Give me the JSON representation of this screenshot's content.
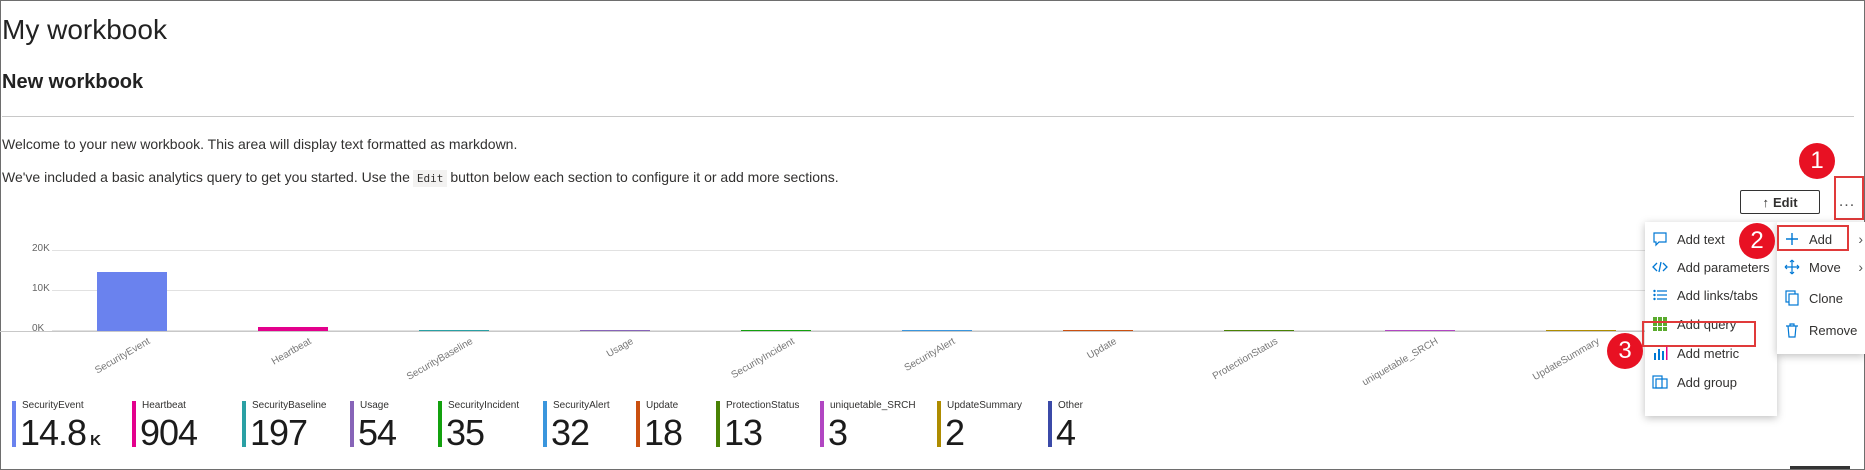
{
  "page": {
    "title": "My workbook",
    "section_title": "New workbook",
    "intro_line1": "Welcome to your new workbook. This area will display text formatted as markdown.",
    "intro_line2_pre": "We've included a basic analytics query to get you started. Use the",
    "intro_line2_code": "Edit",
    "intro_line2_post": "button below each section to configure it or add more sections."
  },
  "toolbar": {
    "edit_label": "Edit",
    "edit_icon": "up-arrow-icon",
    "more_label": "..."
  },
  "callouts": [
    "1",
    "2",
    "3"
  ],
  "chart_data": {
    "type": "bar",
    "categories": [
      "SecurityEvent",
      "Heartbeat",
      "SecurityBaseline",
      "Usage",
      "SecurityIncident",
      "SecurityAlert",
      "Update",
      "ProtectionStatus",
      "uniquetable_SRCH",
      "UpdateSummary"
    ],
    "values": [
      14800,
      904,
      197,
      54,
      35,
      32,
      18,
      13,
      3,
      2
    ],
    "colors": [
      "#6a82ee",
      "#e3008c",
      "#2aa0a4",
      "#8764b8",
      "#13a10e",
      "#3a96dd",
      "#ca5010",
      "#498205",
      "#b146c2",
      "#ae8c00"
    ],
    "yticks": [
      "20K",
      "10K",
      "0K"
    ],
    "ylim": [
      0,
      20000
    ],
    "grid": true
  },
  "tiles": [
    {
      "name": "SecurityEvent",
      "value": "14.8",
      "unit": "K",
      "color": "#6a82ee"
    },
    {
      "name": "Heartbeat",
      "value": "904",
      "unit": "",
      "color": "#e3008c"
    },
    {
      "name": "SecurityBaseline",
      "value": "197",
      "unit": "",
      "color": "#2aa0a4"
    },
    {
      "name": "Usage",
      "value": "54",
      "unit": "",
      "color": "#8764b8"
    },
    {
      "name": "SecurityIncident",
      "value": "35",
      "unit": "",
      "color": "#13a10e"
    },
    {
      "name": "SecurityAlert",
      "value": "32",
      "unit": "",
      "color": "#3a96dd"
    },
    {
      "name": "Update",
      "value": "18",
      "unit": "",
      "color": "#ca5010"
    },
    {
      "name": "ProtectionStatus",
      "value": "13",
      "unit": "",
      "color": "#498205"
    },
    {
      "name": "uniquetable_SRCH",
      "value": "3",
      "unit": "",
      "color": "#b146c2"
    },
    {
      "name": "UpdateSummary",
      "value": "2",
      "unit": "",
      "color": "#ae8c00"
    },
    {
      "name": "Other",
      "value": "4",
      "unit": "",
      "color": "#3b4aa8"
    }
  ],
  "add_menu": {
    "items": [
      {
        "label": "Add text",
        "icon": "comment-icon"
      },
      {
        "label": "Add parameters",
        "icon": "code-icon"
      },
      {
        "label": "Add links/tabs",
        "icon": "bulleted-list-icon"
      },
      {
        "label": "Add query",
        "icon": "table-grid-icon"
      },
      {
        "label": "Add metric",
        "icon": "bar-chart-icon"
      },
      {
        "label": "Add group",
        "icon": "group-icon"
      }
    ]
  },
  "context_menu": {
    "items": [
      {
        "label": "Add",
        "icon": "plus-icon"
      },
      {
        "label": "Move",
        "icon": "move-icon"
      },
      {
        "label": "Clone",
        "icon": "copy-icon"
      },
      {
        "label": "Remove",
        "icon": "trash-icon"
      }
    ]
  }
}
